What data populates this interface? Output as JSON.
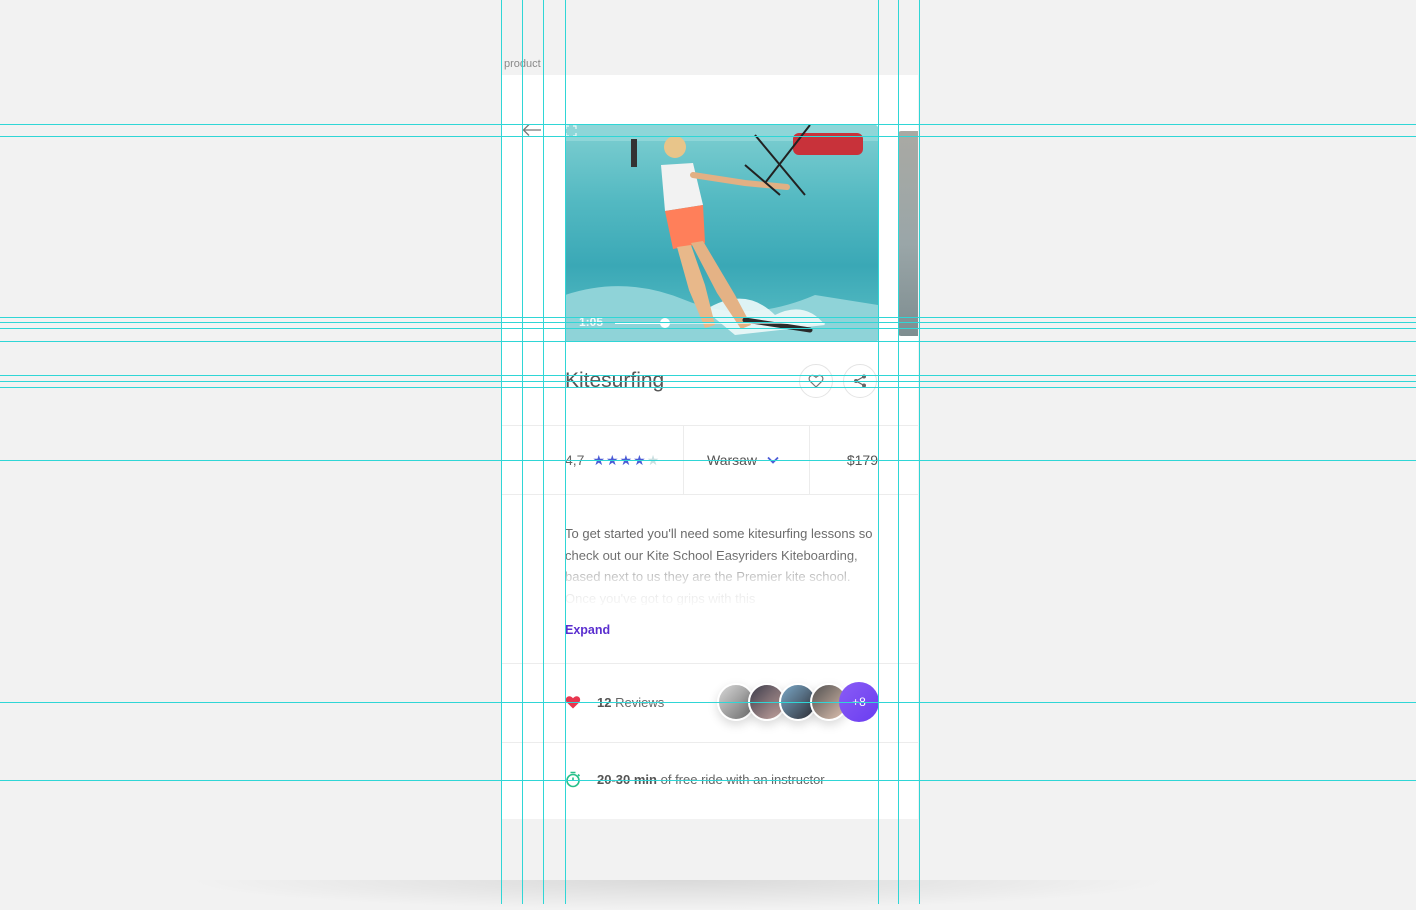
{
  "frame": {
    "label": "product"
  },
  "video": {
    "time": "1:05",
    "progress": 0.24
  },
  "product": {
    "title": "Kitesurfing"
  },
  "info": {
    "rating_value": "4,7",
    "stars": 4,
    "stars_max": 5,
    "city": "Warsaw",
    "price": "$179"
  },
  "description": {
    "text": "To get started you'll need some kitesurfing lessons so check out our Kite School Easyriders Kiteboarding, based next to us they are the Premier kite school. Once you've got to grips with this",
    "expand_label": "Expand"
  },
  "reviews": {
    "count": "12",
    "label": "Reviews",
    "more": "+8"
  },
  "duration": {
    "value": "20-30 min",
    "suffix": "of free ride with an instructor"
  },
  "colors": {
    "accent_purple": "#5a2ecf",
    "star_blue": "#4a5bd6",
    "heart_red": "#e8364f",
    "timer_green": "#28c08a",
    "guide_cyan": "#2fd6d6"
  }
}
